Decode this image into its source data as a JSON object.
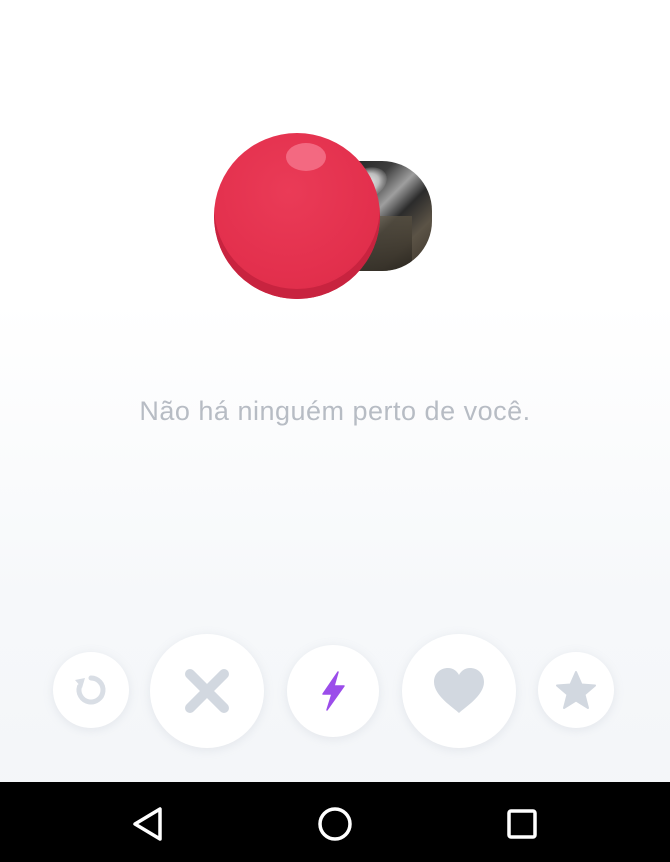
{
  "main": {
    "empty_message": "Não há ninguém perto de você."
  },
  "action_bar": {
    "buttons": [
      {
        "name": "rewind",
        "icon": "rewind-icon",
        "color": "#d9dee5"
      },
      {
        "name": "nope",
        "icon": "close-icon",
        "color": "#d2d8e0"
      },
      {
        "name": "boost",
        "icon": "lightning-icon",
        "color": "#9b4dea"
      },
      {
        "name": "like",
        "icon": "heart-icon",
        "color": "#d2d8e0"
      },
      {
        "name": "super-like",
        "icon": "star-icon",
        "color": "#d2d8e0"
      }
    ]
  },
  "system_nav": {
    "buttons": [
      {
        "name": "back",
        "icon": "back-triangle-icon"
      },
      {
        "name": "home",
        "icon": "home-circle-icon"
      },
      {
        "name": "recents",
        "icon": "recents-square-icon"
      }
    ]
  },
  "colors": {
    "accent_red": "#e3304d",
    "boost_purple": "#9b4dea",
    "muted_icon": "#d2d8e0",
    "message_text": "#b7bcc4"
  }
}
